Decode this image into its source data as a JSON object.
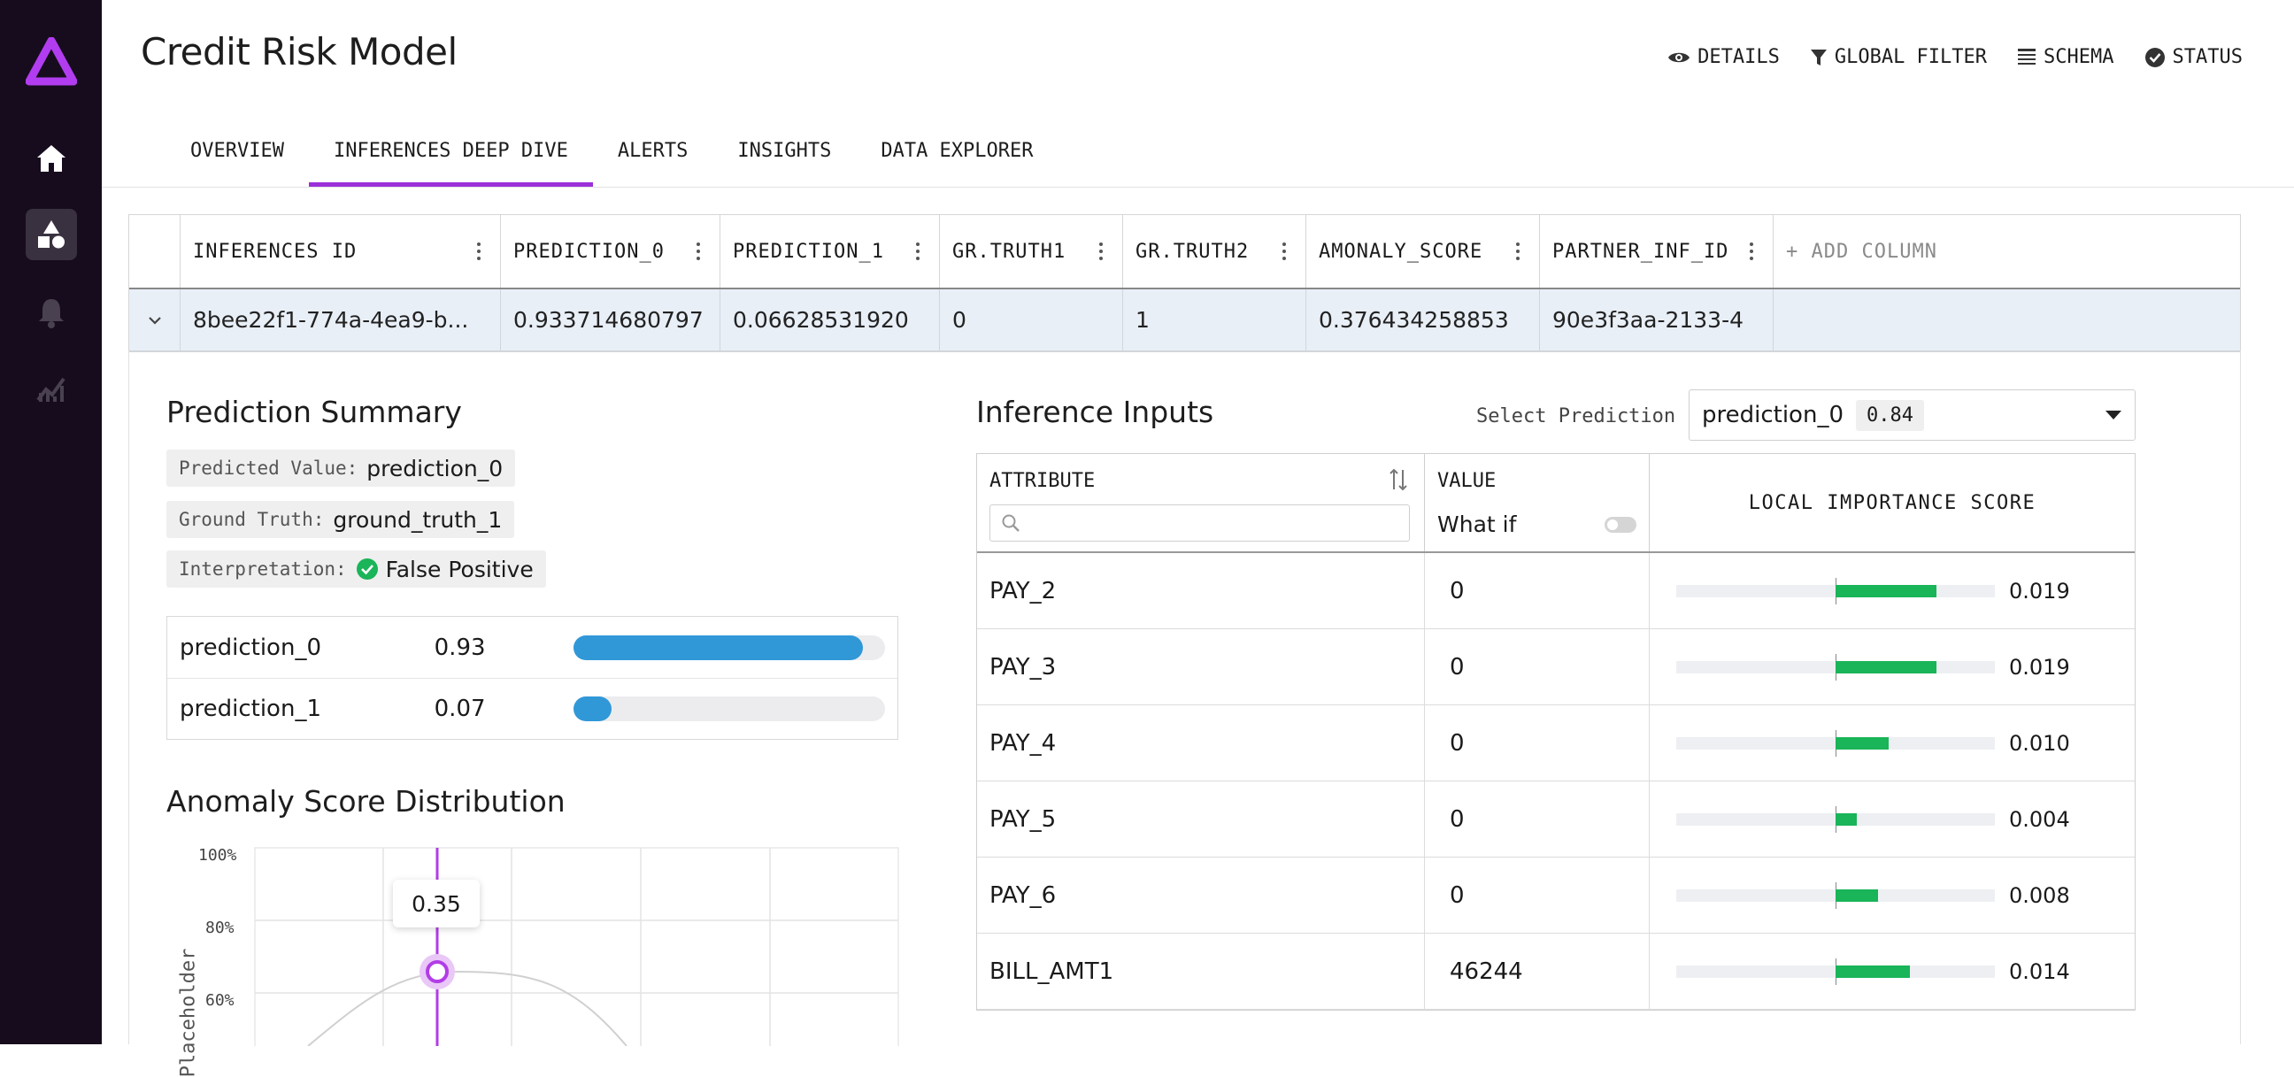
{
  "app": {
    "title": "Credit Risk Model"
  },
  "header_actions": [
    {
      "label": "DETAILS",
      "icon": "eye-icon"
    },
    {
      "label": "GLOBAL FILTER",
      "icon": "filter-icon"
    },
    {
      "label": "SCHEMA",
      "icon": "schema-icon"
    },
    {
      "label": "STATUS",
      "icon": "check-circle-icon"
    }
  ],
  "sidebar": {
    "items": [
      {
        "icon": "home-icon"
      },
      {
        "icon": "models-icon",
        "active": true
      },
      {
        "icon": "bell-icon"
      },
      {
        "icon": "analytics-icon"
      }
    ]
  },
  "tabs": [
    {
      "label": "OVERVIEW"
    },
    {
      "label": "INFERENCES DEEP DIVE",
      "active": true
    },
    {
      "label": "ALERTS"
    },
    {
      "label": "INSIGHTS"
    },
    {
      "label": "DATA EXPLORER"
    }
  ],
  "grid": {
    "columns": [
      "INFERENCES ID",
      "PREDICTION_0",
      "PREDICTION_1",
      "GR.TRUTH1",
      "GR.TRUTH2",
      "AMONALY_SCORE",
      "PARTNER_INF_ID"
    ],
    "add_column": "+ ADD COLUMN",
    "row": [
      "8bee22f1-774a-4ea9-b...",
      "0.933714680797",
      "0.06628531920",
      "0",
      "1",
      "0.376434258853",
      "90e3f3aa-2133-4"
    ]
  },
  "summary": {
    "title": "Prediction Summary",
    "predicted_label": "Predicted Value:",
    "predicted_value": "prediction_0",
    "truth_label": "Ground Truth:",
    "truth_value": "ground_truth_1",
    "interp_label": "Interpretation:",
    "interp_value": "False Positive",
    "predictions": [
      {
        "name": "prediction_0",
        "value": "0.93",
        "fraction": 0.93
      },
      {
        "name": "prediction_1",
        "value": "0.07",
        "fraction": 0.07
      }
    ]
  },
  "anomaly": {
    "title": "Anomaly Score Distribution",
    "ylabel": "Placeholder",
    "yticks": [
      "100%",
      "80%",
      "60%"
    ],
    "tooltip": "0.35"
  },
  "inputs": {
    "title": "Inference Inputs",
    "select_label": "Select Prediction",
    "select_value": "prediction_0",
    "select_badge": "0.84",
    "col_attribute": "ATTRIBUTE",
    "col_value": "VALUE",
    "what_if": "What if",
    "col_importance": "LOCAL IMPORTANCE SCORE",
    "search_placeholder": "",
    "rows": [
      {
        "attribute": "PAY_2",
        "value": "0",
        "score": "0.019",
        "importance": 0.019
      },
      {
        "attribute": "PAY_3",
        "value": "0",
        "score": "0.019",
        "importance": 0.019
      },
      {
        "attribute": "PAY_4",
        "value": "0",
        "score": "0.010",
        "importance": 0.01
      },
      {
        "attribute": "PAY_5",
        "value": "0",
        "score": "0.004",
        "importance": 0.004
      },
      {
        "attribute": "PAY_6",
        "value": "0",
        "score": "0.008",
        "importance": 0.008
      },
      {
        "attribute": "BILL_AMT1",
        "value": "46244",
        "score": "0.014",
        "importance": 0.014
      }
    ]
  },
  "colors": {
    "accent": "#9b30d9",
    "sidebar": "#170c1d",
    "bar_blue": "#3198d8",
    "bar_green": "#1ab459"
  }
}
